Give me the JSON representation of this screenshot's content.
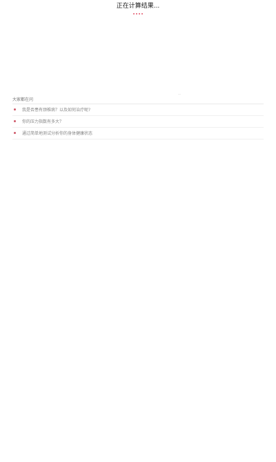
{
  "loading": {
    "title": "正在计算结果..."
  },
  "related": {
    "header": "大家都在问",
    "questions": [
      {
        "text": "我是否患有颈椎病？以及如何治疗呢?"
      },
      {
        "text": "你的压力指数有多大？"
      },
      {
        "text": "通过简单地测试分析你的身体健康状态"
      }
    ]
  },
  "colors": {
    "accent": "#e2576a",
    "text_primary": "#222222",
    "text_muted": "#888888"
  }
}
